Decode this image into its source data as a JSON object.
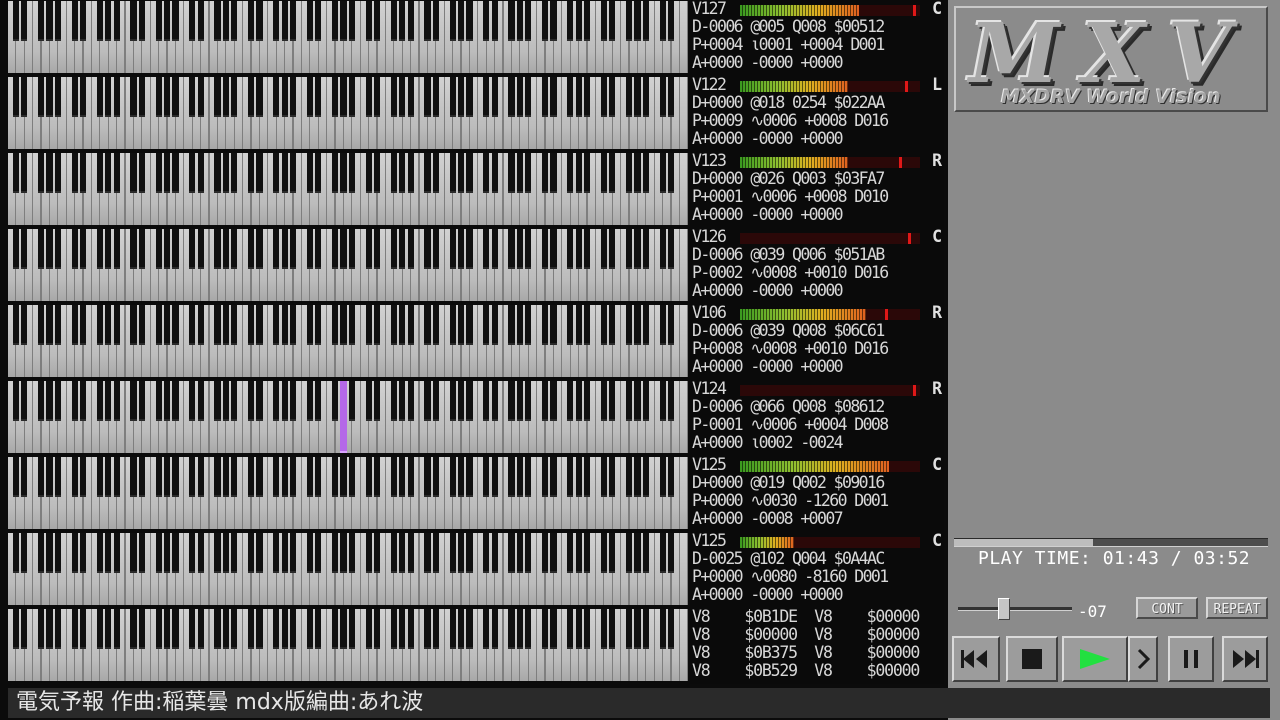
{
  "colors": {
    "active_note": "#b468e8",
    "meter_peak": "#e01818"
  },
  "channels": [
    {
      "lines": [
        "V127",
        "D-0006 @005 Q008 $00512",
        "P+0004 ι0001 +0004 D001",
        "A+0000 -0000 +0000"
      ],
      "pan": "C",
      "level": 0.66,
      "peak": 0.98,
      "active_keys": []
    },
    {
      "lines": [
        "V122",
        "D+0000 @018 0254 $022AA",
        "P+0009 ∿0006 +0008 D016",
        "A+0000 -0000 +0000"
      ],
      "pan": "L",
      "level": 0.6,
      "peak": 0.93,
      "active_keys": []
    },
    {
      "lines": [
        "V123",
        "D+0000 @026 Q003 $03FA7",
        "P+0001 ∿0006 +0008 D010",
        "A+0000 -0000 +0000"
      ],
      "pan": "R",
      "level": 0.6,
      "peak": 0.9,
      "active_keys": []
    },
    {
      "lines": [
        "V126",
        "D-0006 @039 Q006 $051AB",
        "P-0002 ∿0008 +0010 D016",
        "A+0000 -0000 +0000"
      ],
      "pan": "C",
      "level": 0.0,
      "peak": 0.95,
      "active_keys": []
    },
    {
      "lines": [
        "V106",
        "D-0006 @039 Q008 $06C61",
        "P+0008 ∿0008 +0010 D016",
        "A+0000 -0000 +0000"
      ],
      "pan": "R",
      "level": 0.7,
      "peak": 0.82,
      "active_keys": []
    },
    {
      "lines": [
        "V124",
        "D-0006 @066 Q008 $08612",
        "P-0001 ∿0006 +0004 D008",
        "A+0000 ι0002 -0024"
      ],
      "pan": "R",
      "level": 0.0,
      "peak": 0.98,
      "active_keys": [
        28
      ]
    },
    {
      "lines": [
        "V125",
        "D+0000 @019 Q002 $09016",
        "P+0000 ∿0030 -1260 D001",
        "A+0000 -0008 +0007"
      ],
      "pan": "C",
      "level": 0.83,
      "peak": 0.0,
      "active_keys": []
    },
    {
      "lines": [
        "V125",
        "D-0025 @102 Q004 $0A4AC",
        "P+0000 ∿0080 -8160 D001",
        "A+0000 -0000 +0000"
      ],
      "pan": "C",
      "level": 0.3,
      "peak": 0.0,
      "active_keys": []
    }
  ],
  "rhythm": {
    "lines": [
      "V8    $0B1DE  V8    $00000",
      "V8    $00000  V8    $00000",
      "V8    $0B375  V8    $00000",
      "V8    $0B529  V8    $00000"
    ]
  },
  "logo": {
    "main": "MXV",
    "subtitle": "MXDRV World Vision"
  },
  "playback": {
    "label": "PLAY TIME:",
    "current": "01:43",
    "separator": "/",
    "total": "03:52",
    "progress": 0.444
  },
  "volume": {
    "value": "-07",
    "level": 0.38
  },
  "buttons": {
    "cont": "CONT",
    "repeat": "REPEAT"
  },
  "song": {
    "title": "電気予報 作曲:稲葉曇 mdx版編曲:あれ波"
  }
}
